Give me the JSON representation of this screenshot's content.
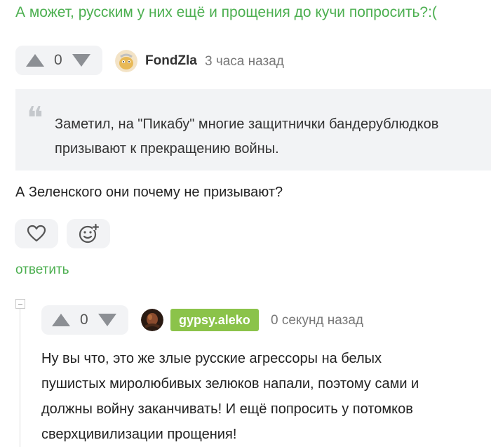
{
  "top_comment_text": "А может, русским у них ещё и прощения до кучи попросить?:(",
  "comment1": {
    "vote_count": "0",
    "username": "FondZla",
    "time": "3 часа назад",
    "quote_line1": "Заметил, на \"Пикабу\" многие защитнички бандерублюдков",
    "quote_line2": "призывают к прекращению войны.",
    "body": "А Зеленского они почему не призывают?",
    "reply_label": "ответить"
  },
  "comment2": {
    "vote_count": "0",
    "username": "gypsy.aleko",
    "time": "0 секунд назад",
    "line1": "Ну вы что, это же злые русские агрессоры на белых",
    "line2": "пушистых миролюбивых зелюков напали, поэтому сами и",
    "line3": "должны войну заканчивать! И ещё попросить у потомков",
    "line4": "сверхцивилизации прощения!"
  },
  "colors": {
    "accent": "#4caf50",
    "badge": "#8bc34a",
    "panel": "#f2f3f5"
  }
}
